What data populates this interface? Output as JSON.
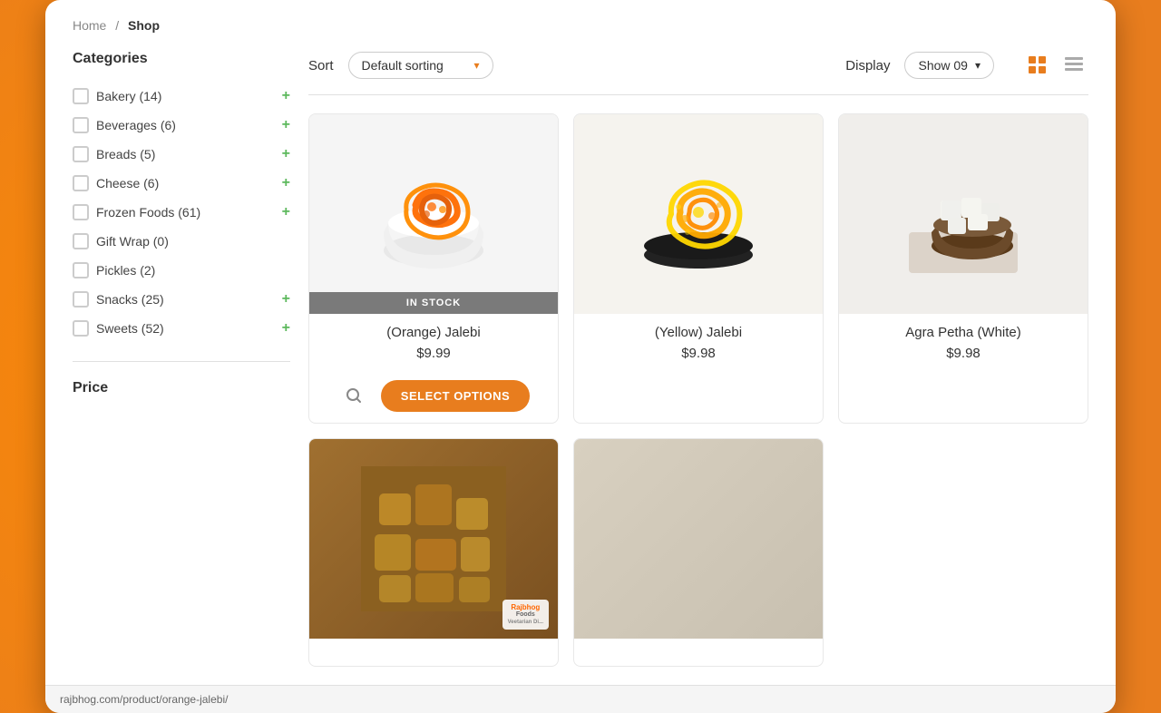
{
  "breadcrumb": {
    "home": "Home",
    "separator": "/",
    "current": "Shop"
  },
  "sidebar": {
    "categories_title": "Categories",
    "items": [
      {
        "id": "bakery",
        "label": "Bakery (14)",
        "has_plus": true
      },
      {
        "id": "beverages",
        "label": "Beverages (6)",
        "has_plus": true
      },
      {
        "id": "breads",
        "label": "Breads (5)",
        "has_plus": true
      },
      {
        "id": "cheese",
        "label": "Cheese (6)",
        "has_plus": true
      },
      {
        "id": "frozen-foods",
        "label": "Frozen Foods (61)",
        "has_plus": true
      },
      {
        "id": "gift-wrap",
        "label": "Gift Wrap (0)",
        "has_plus": false
      },
      {
        "id": "pickles",
        "label": "Pickles (2)",
        "has_plus": false
      },
      {
        "id": "snacks",
        "label": "Snacks (25)",
        "has_plus": true
      },
      {
        "id": "sweets",
        "label": "Sweets (52)",
        "has_plus": true
      }
    ],
    "price_title": "Price"
  },
  "toolbar": {
    "sort_label": "Sort",
    "sort_value": "Default sorting",
    "display_label": "Display",
    "display_value": "Show 09",
    "grid_icon": "grid-view",
    "list_icon": "list-view"
  },
  "products": [
    {
      "id": "orange-jalebi",
      "name": "(Orange) Jalebi",
      "price": "$9.99",
      "in_stock": true,
      "stock_label": "IN STOCK",
      "has_actions": true,
      "select_label": "SELECT OPTIONS",
      "color": "#fff8f0",
      "emoji": "🍩"
    },
    {
      "id": "yellow-jalebi",
      "name": "(Yellow) Jalebi",
      "price": "$9.98",
      "in_stock": false,
      "has_actions": false,
      "color": "#f5f3ee",
      "emoji": "🍩"
    },
    {
      "id": "agra-petha-white",
      "name": "Agra Petha (White)",
      "price": "$9.98",
      "in_stock": false,
      "has_actions": false,
      "color": "#f0eeeb",
      "emoji": "🍚"
    },
    {
      "id": "product-4",
      "name": "",
      "price": "",
      "in_stock": false,
      "has_actions": false,
      "color": "#8B6914",
      "emoji": "",
      "is_rajbhog": true
    },
    {
      "id": "product-5",
      "name": "",
      "price": "",
      "in_stock": false,
      "has_actions": false,
      "color": "#d8d0c0",
      "emoji": ""
    }
  ],
  "url_bar": {
    "url": "rajbhog.com/product/orange-jalebi/"
  }
}
